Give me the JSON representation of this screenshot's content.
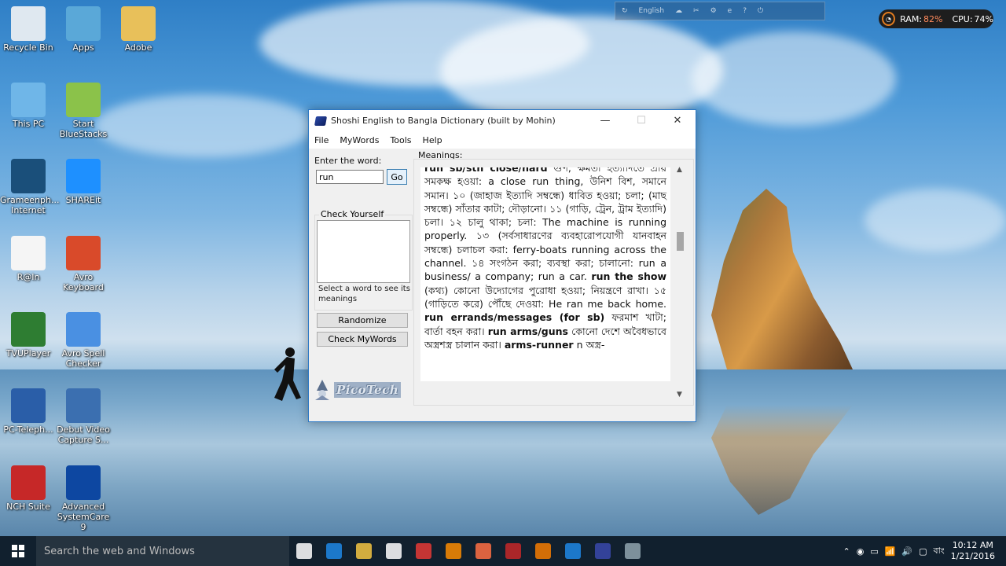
{
  "desktop": {
    "icons": [
      {
        "label": "Recycle Bin",
        "icon": "recycle-bin-icon"
      },
      {
        "label": "Apps",
        "icon": "apps-icon"
      },
      {
        "label": "Adobe",
        "icon": "folder-icon"
      },
      {
        "label": "This PC",
        "icon": "this-pc-icon"
      },
      {
        "label": "Start BlueStacks",
        "icon": "bluestacks-icon"
      },
      {
        "label": "Grameenph... Internet",
        "icon": "grameenphone-icon"
      },
      {
        "label": "SHAREit",
        "icon": "shareit-icon"
      },
      {
        "label": "R@In",
        "icon": "text-file-icon"
      },
      {
        "label": "Avro Keyboard",
        "icon": "avro-keyboard-icon"
      },
      {
        "label": "TVUPlayer",
        "icon": "tvu-player-icon"
      },
      {
        "label": "Avro Spell Checker",
        "icon": "spell-checker-icon"
      },
      {
        "label": "PC-Teleph...",
        "icon": "pc-telephone-icon"
      },
      {
        "label": "Debut Video Capture S...",
        "icon": "video-capture-icon"
      },
      {
        "label": "NCH Suite",
        "icon": "nch-suite-icon"
      },
      {
        "label": "Advanced SystemCare 9",
        "icon": "systemcare-icon"
      }
    ]
  },
  "topwidget": {
    "lang": "English"
  },
  "sysmon": {
    "ram_label": "RAM:",
    "ram_value": "82%",
    "cpu_label": "CPU:",
    "cpu_value": "74%"
  },
  "window": {
    "title": "Shoshi English to Bangla Dictionary (built by Mohin)",
    "minimize": "—",
    "maximize": "☐",
    "close": "✕",
    "menu": [
      "File",
      "MyWords",
      "Tools",
      "Help"
    ],
    "word_label": "Enter the word:",
    "word_value": "run",
    "go_label": "Go",
    "check_legend": "Check Yourself",
    "check_hint": "Select a word to see its meanings",
    "randomize_label": "Randomize",
    "check_mywords_label": "Check MyWords",
    "logo_text": "PicoTech",
    "meanings_label": "Meanings:",
    "meanings": [
      {
        "b": "run sb/sth close/hard",
        "t": " গুণ, ক্ষমতা ইত্যাদিতে প্রায় সমকক্ষ হওয়া: a close run thing, উনিশ বিশ, সমানে সমান। ১০ (জাহাজ ইত্যাদি সম্বন্ধে) ধাবিত হওয়া; চলা; (মাছ সম্বন্ধে) সাঁতার কাটা; দৌড়ানো। ১১ (গাড়ি, ট্রেন, ট্রাম ইত্যাদি) চলা। ১২ চালু থাকা; চলা: The machine is running properly. ১৩ (সর্বসাধারণের ব্যবহারোপযোগী যানবাহন সম্বন্ধে) চলাচল করা: ferry-boats running across the channel. ১৪ সংগঠন করা; ব্যবস্থা করা; চালানো: run a business/ a company; run a car. "
      },
      {
        "b": "run the show",
        "t": " (কথ্য) কোনো উদ্যোগের পুরোধা হওয়া; নিয়ন্ত্রণে রাখা। ১৫ (গাড়িতে করে) পৌঁছে দেওয়া: He ran me back home. "
      },
      {
        "b": "run errands/messages (for sb)",
        "t": " ফরমাশ খাটা; বার্তা বহন করা। "
      },
      {
        "b": "run arms/guns",
        "t": " কোনো দেশে অবৈধভাবে অস্ত্রশস্ত্র চালান করা। "
      },
      {
        "b": "arms-runner",
        "t": " n অস্ত্র-"
      }
    ]
  },
  "taskbar": {
    "search_placeholder": "Search the web and Windows",
    "apps": [
      "task-view-icon",
      "edge-icon",
      "explorer-icon",
      "store-icon",
      "chrome-icon",
      "xampp-icon",
      "firefox-icon",
      "dictionary-red-icon",
      "vlc-icon",
      "systemcare-icon",
      "dictionary-app-icon",
      "tool-icon"
    ],
    "lang": "বাং",
    "time": "10:12 AM",
    "date": "1/21/2016"
  },
  "colors": {
    "accent": "#2b78c6",
    "taskbar": "#11202e",
    "ram": "#ff8a5b"
  }
}
